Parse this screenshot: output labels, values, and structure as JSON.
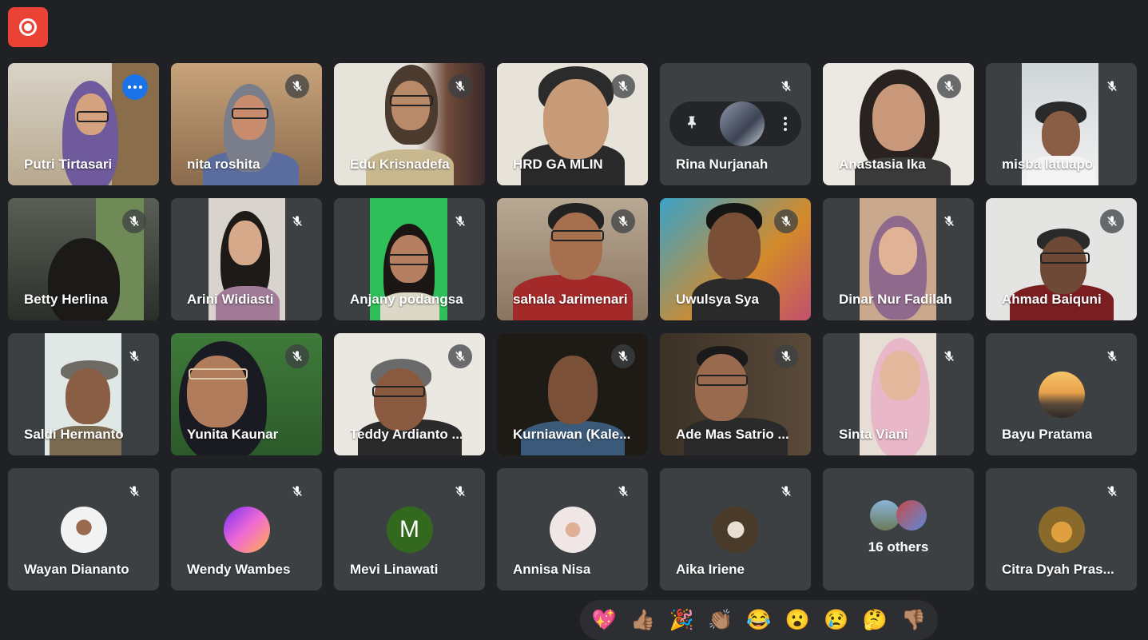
{
  "participants": [
    {
      "name": "Putri Tirtasari"
    },
    {
      "name": "nita roshita"
    },
    {
      "name": "Edu Krisnadefa"
    },
    {
      "name": "HRD GA MLIN"
    },
    {
      "name": "Rina Nurjanah"
    },
    {
      "name": "Anastasia Ika"
    },
    {
      "name": "misba latuapo"
    },
    {
      "name": "Betty Herlina"
    },
    {
      "name": "Arini Widiasti"
    },
    {
      "name": "Anjany podangsa"
    },
    {
      "name": "sahala Jarimenari"
    },
    {
      "name": "Uwulsya Sya"
    },
    {
      "name": "Dinar Nur Fadilah"
    },
    {
      "name": "Ahmad Baiquni"
    },
    {
      "name": "Saldi Hermanto"
    },
    {
      "name": "Yunita Kaunar"
    },
    {
      "name": "Teddy Ardianto ..."
    },
    {
      "name": "Kurniawan (Kale..."
    },
    {
      "name": "Ade Mas Satrio ..."
    },
    {
      "name": "Sinta Viani"
    },
    {
      "name": "Bayu Pratama"
    },
    {
      "name": "Wayan Diananto"
    },
    {
      "name": "Wendy Wambes"
    },
    {
      "name": "Mevi Linawati",
      "initial": "M"
    },
    {
      "name": "Annisa Nisa"
    },
    {
      "name": "Aika Iriene"
    },
    {
      "name": "16 others"
    },
    {
      "name": "Citra Dyah Pras..."
    }
  ],
  "reactions": [
    "💖",
    "👍🏽",
    "🎉",
    "👏🏽",
    "😂",
    "😮",
    "😢",
    "🤔",
    "👎🏽"
  ],
  "colors": {
    "background": "#202124",
    "tile": "#3c4043",
    "record": "#ea4335",
    "active_border": "#8ab4f8",
    "more_button": "#1a73e8"
  }
}
